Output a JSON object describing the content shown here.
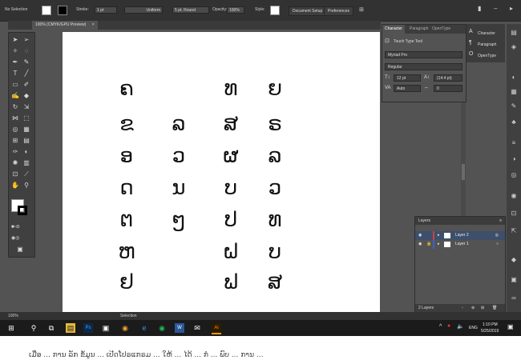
{
  "control_bar": {
    "selection": "No Selection",
    "stroke_label": "Stroke:",
    "stroke_value": "1 pt",
    "uniform": "Uniform",
    "brush": "5 pt. Round",
    "opacity_label": "Opacity:",
    "opacity_value": "100%",
    "style_label": "Style:",
    "doc_setup": "Document Setup",
    "preferences": "Preferences"
  },
  "document_tab": {
    "label": "100% (CMYK/GPU Preview)",
    "close": "×"
  },
  "glyphs": [
    "ຄ",
    "ທ",
    "ຍ",
    "ຂ",
    "ລ",
    "ສ",
    "ຣ",
    "ອ",
    "ວ",
    "ຜ",
    "ລ",
    "ດ",
    "ນ",
    "ບ",
    "ວ",
    "ຕ",
    "ໆ",
    "ປ",
    "ທ",
    "ຫ",
    "ຝ",
    "ບ",
    "ຢ",
    "ຟ",
    "ສ"
  ],
  "character_panel": {
    "tabs": [
      "Character",
      "Paragraph",
      "OpenType"
    ],
    "touch_type": "Touch Type Tool",
    "font": "Myriad Pro",
    "style": "Regular",
    "size": "12 pt",
    "leading": "(14.4 pt)",
    "kerning": "Auto",
    "tracking": "0"
  },
  "dock": {
    "items": [
      "Character",
      "Paragraph",
      "OpenType"
    ]
  },
  "layers_panel": {
    "title": "Layers",
    "rows": [
      "Layer 2",
      "Layer 1"
    ],
    "footer": "2 Layers"
  },
  "status_bar": {
    "zoom": "100%",
    "mode": "Selection"
  },
  "taskbar": {
    "lang": "ENG",
    "time": "1:10 PM",
    "date": "5/25/2019"
  },
  "bottom_text": "ເມື່ອ ... ການ ລັກ ຂໍ້ມູນ ... ເປີດໂປຣແກຣມ ... ໃຫ້ ... ໄດ້ ... ກໍ ... ພົບ ... ການ ..."
}
